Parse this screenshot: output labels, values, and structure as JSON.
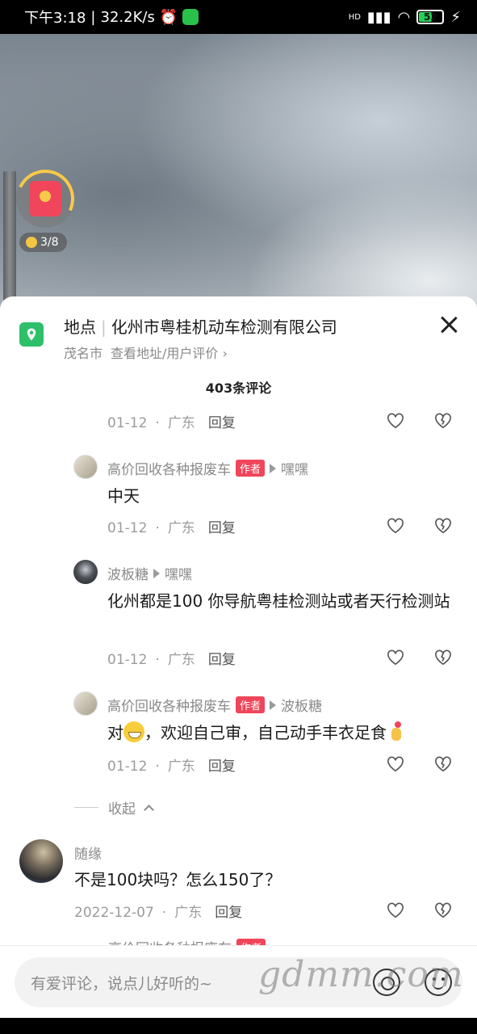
{
  "status_bar": {
    "time": "下午3:18",
    "network_speed": "32.2K/s",
    "hd": "HD",
    "battery": "52"
  },
  "floating": {
    "coin_progress": "3/8"
  },
  "location": {
    "label": "地点",
    "name": "化州市粤桂机动车检测有限公司",
    "city": "茂名市",
    "view_link": "查看地址/用户评价"
  },
  "comments_count": "403条评论",
  "comments": [
    {
      "date": "01-12",
      "region": "广东",
      "reply": "回复"
    },
    {
      "author": "高价回收各种报废车",
      "badge": "作者",
      "reply_to": "嘿嘿",
      "text": "中天",
      "date": "01-12",
      "region": "广东",
      "reply": "回复"
    },
    {
      "author": "波板糖",
      "reply_to": "嘿嘿",
      "text": "化州都是100  你导航粤桂检测站或者天行检测站",
      "date": "01-12",
      "region": "广东",
      "reply": "回复"
    },
    {
      "author": "高价回收各种报废车",
      "badge": "作者",
      "reply_to": "波板糖",
      "text_before": "对",
      "text_after": "，欢迎自己审，自己动手丰衣足食",
      "date": "01-12",
      "region": "广东",
      "reply": "回复"
    },
    {
      "author": "随缘",
      "text": "不是100块吗？怎么150了？",
      "date": "2022-12-07",
      "region": "广东",
      "reply": "回复"
    }
  ],
  "collapse_label": "收起",
  "input": {
    "placeholder": "有爱评论，说点儿好听的~"
  },
  "watermark": "gdmm.com",
  "icons": [
    "location-pin-icon",
    "close-icon",
    "heart-icon",
    "dislike-icon",
    "at-icon",
    "emoji-icon",
    "red-packet-icon",
    "coin-icon"
  ]
}
